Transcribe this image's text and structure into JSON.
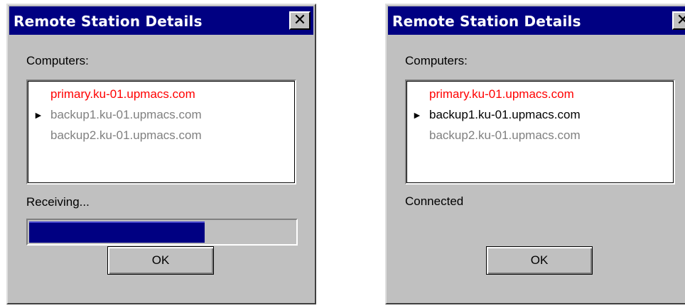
{
  "dialogs": [
    {
      "title": "Remote Station Details",
      "close_glyph": "✕",
      "computers_label": "Computers:",
      "computers": [
        {
          "name": "primary.ku-01.upmacs.com",
          "color": "#ff0000",
          "active": false
        },
        {
          "name": "backup1.ku-01.upmacs.com",
          "color": "#808080",
          "active": true
        },
        {
          "name": "backup2.ku-01.upmacs.com",
          "color": "#808080",
          "active": false
        }
      ],
      "arrow_glyph": "►",
      "status": "Receiving...",
      "progress": 0.66,
      "ok_label": "OK"
    },
    {
      "title": "Remote Station Details",
      "close_glyph": "✕",
      "computers_label": "Computers:",
      "computers": [
        {
          "name": "primary.ku-01.upmacs.com",
          "color": "#ff0000",
          "active": false
        },
        {
          "name": "backup1.ku-01.upmacs.com",
          "color": "#000000",
          "active": true
        },
        {
          "name": "backup2.ku-01.upmacs.com",
          "color": "#808080",
          "active": false
        }
      ],
      "arrow_glyph": "►",
      "status": "Connected",
      "ok_label": "OK"
    }
  ],
  "colors": {
    "title_bar": "#000082",
    "dialog_face": "#c0c0c0",
    "progress_fill": "#000082"
  }
}
